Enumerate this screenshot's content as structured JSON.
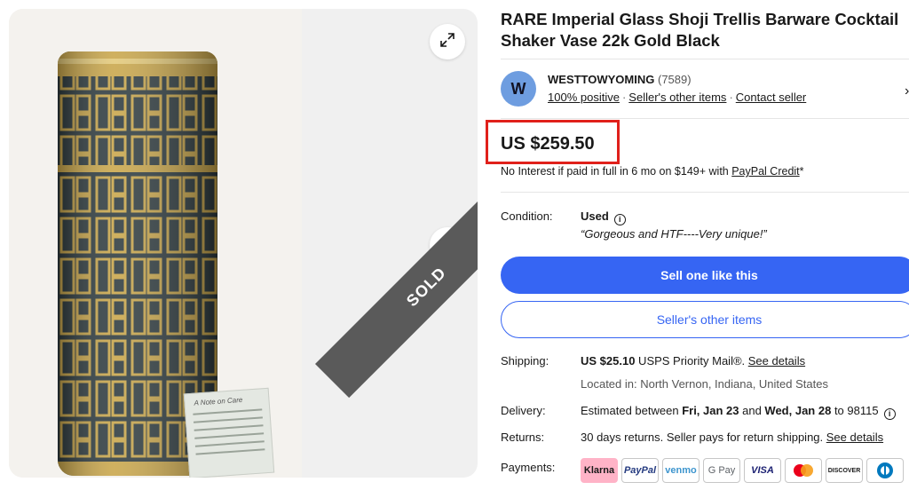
{
  "listing": {
    "title": "RARE Imperial Glass Shoji Trellis Barware Cocktail Shaker Vase 22k Gold Black",
    "sold_label": "SOLD",
    "card_text": "A Note on Care"
  },
  "seller": {
    "initial": "W",
    "name": "WESTTOWYOMING",
    "feedback_count": "(7589)",
    "positive": "100% positive",
    "other_items": "Seller's other items",
    "contact": "Contact seller"
  },
  "price": {
    "amount": "US $259.50",
    "credit_text": "No Interest if paid in full in 6 mo on $149+ with ",
    "credit_link": "PayPal Credit",
    "credit_suffix": "*"
  },
  "condition": {
    "label": "Condition:",
    "value": "Used",
    "note": "“Gorgeous and HTF----Very unique!”"
  },
  "buttons": {
    "sell_one": "Sell one like this",
    "seller_other": "Seller's other items"
  },
  "shipping": {
    "label": "Shipping:",
    "cost": "US $25.10",
    "service": " USPS Priority Mail®. ",
    "details_link": "See details",
    "location": "Located in: North Vernon, Indiana, United States"
  },
  "delivery": {
    "label": "Delivery:",
    "prefix": "Estimated between ",
    "date1": "Fri, Jan 23",
    "and": " and ",
    "date2": "Wed, Jan 28",
    "suffix": " to 98115"
  },
  "returns": {
    "label": "Returns:",
    "text": "30 days returns. Seller pays for return shipping. ",
    "details_link": "See details"
  },
  "payments": {
    "label": "Payments:",
    "methods": [
      "Klarna",
      "PayPal",
      "venmo",
      "G Pay",
      "VISA",
      "Mastercard",
      "DISCOVER",
      "Diners Club"
    ]
  },
  "colors": {
    "accent": "#3665f3",
    "highlight": "#e0201b",
    "klarna": "#ffb3c7"
  }
}
